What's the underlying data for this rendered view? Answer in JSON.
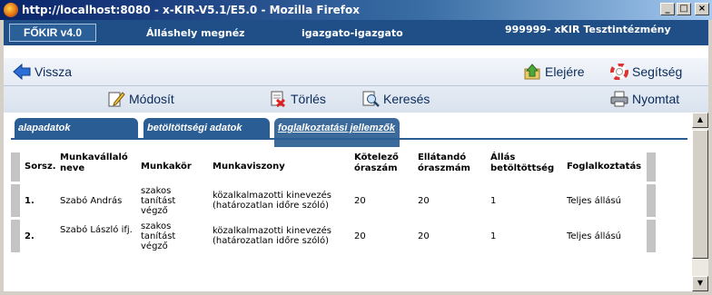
{
  "window": {
    "title": "http://localhost:8080 - x-KIR-V5.1/E5.0 - Mozilla Firefox",
    "minimize": "_",
    "maximize": "□",
    "close": "×"
  },
  "header": {
    "brand": "FŐKIR v4.0",
    "module": "Álláshely megnéz",
    "user": "igazgato-igazgato",
    "institution": "999999- xKIR Tesztintézmény"
  },
  "nav": {
    "back": "Vissza",
    "top": "Elejére",
    "help": "Segítség",
    "edit": "Módosít",
    "delete": "Törlés",
    "search": "Keresés",
    "print": "Nyomtat"
  },
  "tabs": [
    {
      "label": "alapadatok"
    },
    {
      "label": "betöltöttségi adatok"
    },
    {
      "label": "foglalkoztatási jellemzők"
    }
  ],
  "table": {
    "headers": [
      "Sorsz.",
      "Munkavállaló neve",
      "Munkakör",
      "Munkaviszony",
      "Kötelező óraszám",
      "Ellátandó óraszmám",
      "Állás betöltöttség",
      "Foglalkoztatás"
    ],
    "rows": [
      {
        "num": "1.",
        "name": "Szabó András",
        "role": "szakos tanítást végző",
        "relation": "közalkalmazotti kinevezés (határozatlan időre szóló)",
        "required": "20",
        "assigned": "20",
        "fill": "1",
        "employment": "Teljes állású"
      },
      {
        "num": "2.",
        "name": "Szabó László ifj.",
        "role": "szakos tanítást végző",
        "relation": "közalkalmazotti kinevezés (határozatlan időre szóló)",
        "required": "20",
        "assigned": "20",
        "fill": "1",
        "employment": "Teljes állású"
      }
    ]
  },
  "colors": {
    "header_bg": "#1f4f86",
    "tab_bg": "#2a5d93",
    "nav_text": "#0a2a5c"
  }
}
